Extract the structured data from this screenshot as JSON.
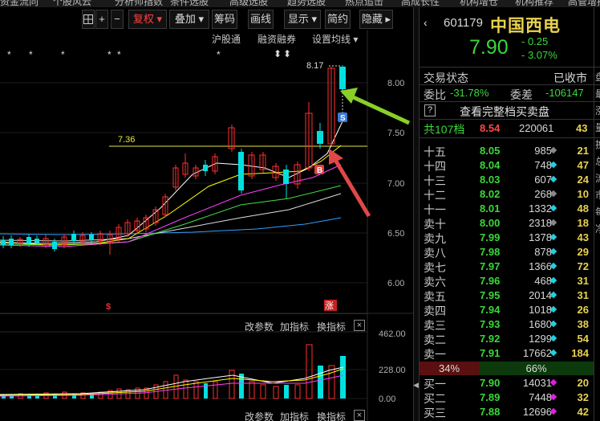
{
  "top_menu": [
    "资金流向",
    "个股风云",
    "分析师指数",
    "条件选股",
    "高级选股",
    "趋势选股",
    "热点追击",
    "高成长性",
    "机构增仓",
    "机构推荐",
    "高管增持"
  ],
  "toolbar": {
    "grid_icon": "grid-icon",
    "plus_label": "+",
    "minus_label": "−",
    "adjust_label": "复权 ▾",
    "overlay_label": "叠加 ▾",
    "chip_label": "筹码",
    "draw_label": "画线",
    "display_label": "显示 ▾",
    "simple_label": "简约",
    "hide_label": "隐藏 ▸"
  },
  "subbar": {
    "hk_connect": "沪股通",
    "margin": "融资融券",
    "ma_settings": "设置均线 ▾"
  },
  "price_axis": [
    "8.00",
    "7.50",
    "7.00",
    "6.50",
    "6.00"
  ],
  "annotations": {
    "high_price": "8.17",
    "ref_line_price": "7.36",
    "buy_marker": "B",
    "sell_marker": "S",
    "limit_up_marker": "涨",
    "dollar_marker": "$"
  },
  "indicator_bar": {
    "params": "改参数",
    "add": "加指标",
    "switch": "换指标",
    "close": "×"
  },
  "volume_axis": [
    "462.00",
    "228.00",
    "0.00"
  ],
  "stock": {
    "back_icon": "chevron-left-icon",
    "code": "601179",
    "name": "中国西电",
    "price": "7.90",
    "change": "- 0.25",
    "change_pct": "- 3.07%"
  },
  "status": {
    "label": "交易状态",
    "value": "已收市"
  },
  "ratio": {
    "wb_label": "委比",
    "wb_value": "-31.78%",
    "wc_label": "委差",
    "wc_value": "-106147"
  },
  "full_depth": {
    "q_icon": "?",
    "label": "查看完整档买卖盘"
  },
  "depth_summary": {
    "label": "共107档",
    "price": "8.54",
    "vol": "220061",
    "count": "43"
  },
  "order_book": [
    {
      "label": "十五",
      "price": "8.05",
      "vol": "985",
      "count": "21",
      "dot": "#888888"
    },
    {
      "label": "十四",
      "price": "8.04",
      "vol": "748",
      "count": "47",
      "dot": "#22d0e0"
    },
    {
      "label": "十三",
      "price": "8.03",
      "vol": "607",
      "count": "24",
      "dot": "#22d0e0"
    },
    {
      "label": "十二",
      "price": "8.02",
      "vol": "268",
      "count": "10",
      "dot": "#888888"
    },
    {
      "label": "十一",
      "price": "8.01",
      "vol": "1332",
      "count": "48",
      "dot": "#22d0e0"
    },
    {
      "label": "卖十",
      "price": "8.00",
      "vol": "2318",
      "count": "18",
      "dot": "#888888"
    },
    {
      "label": "卖九",
      "price": "7.99",
      "vol": "1378",
      "count": "43",
      "dot": "#22d0e0"
    },
    {
      "label": "卖八",
      "price": "7.98",
      "vol": "878",
      "count": "29",
      "dot": "#22d0e0"
    },
    {
      "label": "卖七",
      "price": "7.97",
      "vol": "1366",
      "count": "72",
      "dot": "#22d0e0"
    },
    {
      "label": "卖六",
      "price": "7.96",
      "vol": "468",
      "count": "31",
      "dot": "#22d0e0"
    },
    {
      "label": "卖五",
      "price": "7.95",
      "vol": "2014",
      "count": "31",
      "dot": "#22d0e0"
    },
    {
      "label": "卖四",
      "price": "7.94",
      "vol": "1018",
      "count": "26",
      "dot": "#22d0e0"
    },
    {
      "label": "卖三",
      "price": "7.93",
      "vol": "1680",
      "count": "38",
      "dot": "#22d0e0"
    },
    {
      "label": "卖二",
      "price": "7.92",
      "vol": "1299",
      "count": "54",
      "dot": "#22d0e0"
    },
    {
      "label": "卖一",
      "price": "7.91",
      "vol": "17662",
      "count": "184",
      "dot": "#22d0e0"
    }
  ],
  "buy_sell_ratio": {
    "sell": "34%",
    "buy": "66%"
  },
  "bids": [
    {
      "label": "买一",
      "price": "7.90",
      "vol": "14031",
      "count": "20",
      "dot": "#e020e0"
    },
    {
      "label": "买二",
      "price": "7.89",
      "vol": "7448",
      "count": "32",
      "dot": "#e020e0"
    },
    {
      "label": "买三",
      "price": "7.88",
      "vol": "12696",
      "count": "42",
      "dot": "#e020e0"
    }
  ],
  "edge_labels": [
    "盘",
    "最",
    "涨",
    "量",
    "换",
    "总",
    "流",
    "市",
    "每",
    "净"
  ],
  "colors": {
    "up": "#ff3030",
    "down": "#00e0e0",
    "ma5": "#ffffff",
    "ma10": "#ffff00",
    "ma20": "#ff40ff",
    "ma30": "#40e040",
    "ma60": "#dddddd",
    "ma120": "#30a0ff"
  }
}
